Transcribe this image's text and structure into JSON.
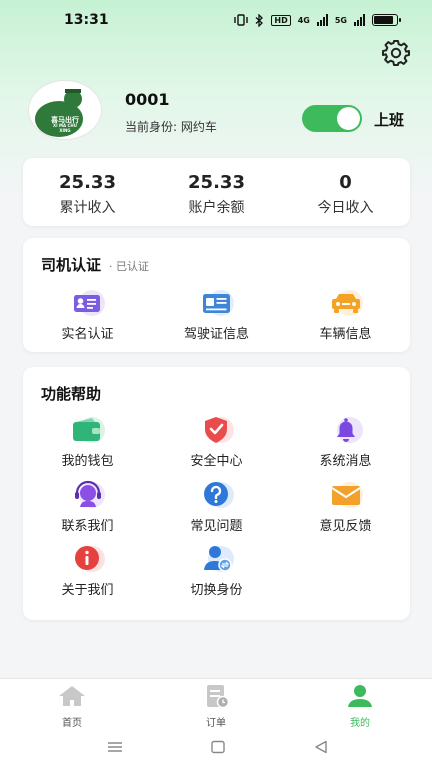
{
  "status_bar": {
    "time": "13:31",
    "network_a": "4G",
    "network_b": "5G",
    "hd": "HD",
    "battery_level": 0.85
  },
  "profile": {
    "avatar_text_top": "喜马出行",
    "avatar_text_bottom": "XI MA CHU XING",
    "name": "0001",
    "role_label": "当前身份:",
    "role_value": "网约车",
    "duty_toggle_on": true,
    "duty_label": "上班"
  },
  "stats": [
    {
      "value": "25.33",
      "label": "累计收入"
    },
    {
      "value": "25.33",
      "label": "账户余额"
    },
    {
      "value": "0",
      "label": "今日收入"
    }
  ],
  "certification": {
    "title": "司机认证",
    "status": "· 已认证",
    "items": [
      {
        "label": "实名认证",
        "icon": "id-card-icon"
      },
      {
        "label": "驾驶证信息",
        "icon": "driver-license-icon"
      },
      {
        "label": "车辆信息",
        "icon": "car-icon"
      }
    ]
  },
  "functions": {
    "title": "功能帮助",
    "items": [
      {
        "label": "我的钱包",
        "icon": "wallet-icon"
      },
      {
        "label": "安全中心",
        "icon": "shield-icon"
      },
      {
        "label": "系统消息",
        "icon": "bell-icon"
      },
      {
        "label": "联系我们",
        "icon": "headset-icon"
      },
      {
        "label": "常见问题",
        "icon": "question-icon"
      },
      {
        "label": "意见反馈",
        "icon": "envelope-icon"
      },
      {
        "label": "关于我们",
        "icon": "info-icon"
      },
      {
        "label": "切换身份",
        "icon": "switch-user-icon"
      }
    ]
  },
  "tabbar": {
    "items": [
      {
        "label": "首页",
        "icon": "home-icon",
        "active": false
      },
      {
        "label": "订单",
        "icon": "order-icon",
        "active": false
      },
      {
        "label": "我的",
        "icon": "person-icon",
        "active": true
      }
    ]
  },
  "colors": {
    "accent": "#3cba5c",
    "gray_icon": "#c8c8c8"
  }
}
